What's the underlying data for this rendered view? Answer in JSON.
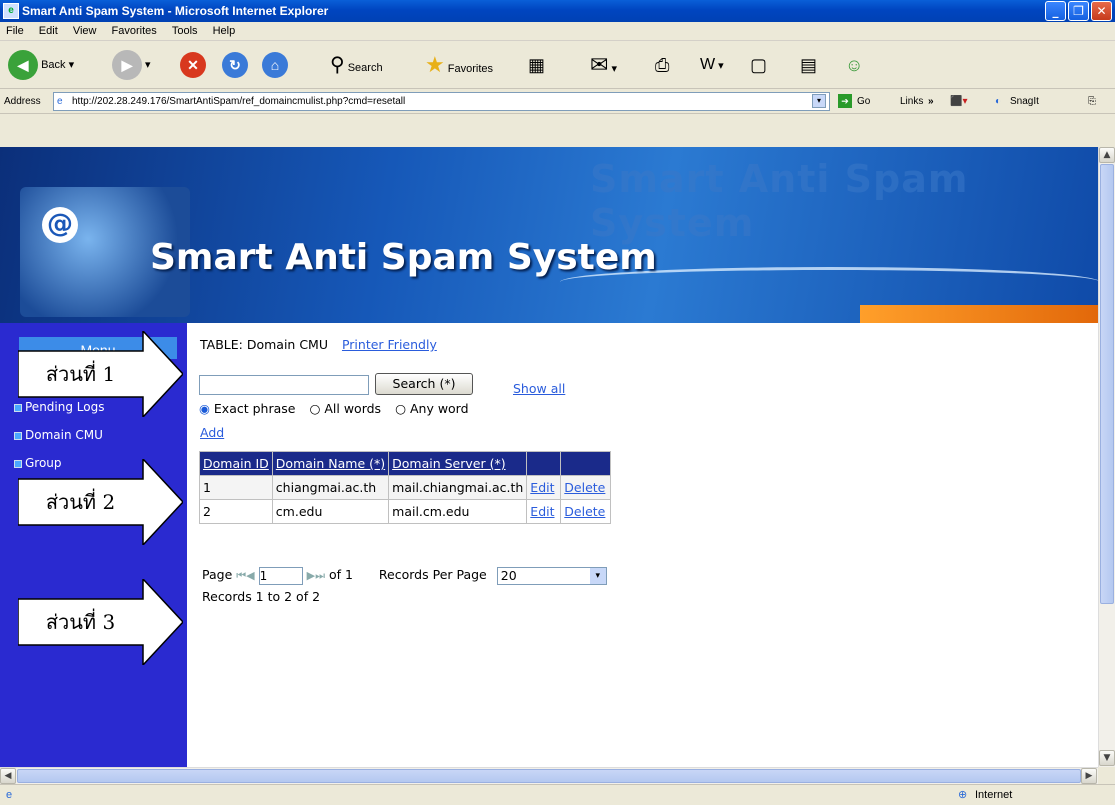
{
  "window": {
    "title": "Smart Anti Spam System - Microsoft Internet Explorer"
  },
  "menubar": {
    "items": [
      "File",
      "Edit",
      "View",
      "Favorites",
      "Tools",
      "Help"
    ]
  },
  "toolbar": {
    "back": "Back",
    "search": "Search",
    "favorites": "Favorites"
  },
  "addressbar": {
    "label": "Address",
    "url": "http://202.28.249.176/SmartAntiSpam/ref_domaincmulist.php?cmd=resetall",
    "go": "Go",
    "links": "Links",
    "snagit": "SnagIt"
  },
  "banner": {
    "title": "Smart Anti Spam System",
    "bg_text": "Smart Anti Spam System"
  },
  "sidebar": {
    "heading": "Menu",
    "items": [
      {
        "label": ""
      },
      {
        "label": "Pending Logs"
      },
      {
        "label": "Domain CMU"
      },
      {
        "label": "Group"
      },
      {
        "label": ""
      },
      {
        "label": ""
      }
    ]
  },
  "content": {
    "table_title": "TABLE: Domain CMU",
    "printer_friendly": "Printer Friendly",
    "search_value": "",
    "search_button": "Search (*)",
    "show_all": "Show all",
    "options": [
      "Exact phrase",
      "All words",
      "Any word"
    ],
    "selected_option": "Exact phrase",
    "add": "Add",
    "table": {
      "headers": [
        "Domain ID",
        "Domain Name (*)",
        "Domain Server (*)",
        "",
        ""
      ],
      "rows": [
        {
          "id": "1",
          "name": "chiangmai.ac.th",
          "server": "mail.chiangmai.ac.th",
          "edit": "Edit",
          "delete": "Delete"
        },
        {
          "id": "2",
          "name": "cm.edu",
          "server": "mail.cm.edu",
          "edit": "Edit",
          "delete": "Delete"
        }
      ]
    },
    "pager": {
      "page_label": "Page",
      "page_value": "1",
      "of_label": "of 1",
      "per_page_label": "Records Per Page",
      "per_page_value": "20",
      "records_text": "Records 1 to 2 of 2"
    }
  },
  "annotations": {
    "part1": "ส่วนที่ 1",
    "part2": "ส่วนที่ 2",
    "part3": "ส่วนที่ 3"
  },
  "statusbar": {
    "zone": "Internet"
  },
  "colors": {
    "accent_blue": "#1a2a8a",
    "sidebar": "#2a2ad0",
    "link": "#2a5cdc",
    "banner_orange": "#e2680a"
  }
}
